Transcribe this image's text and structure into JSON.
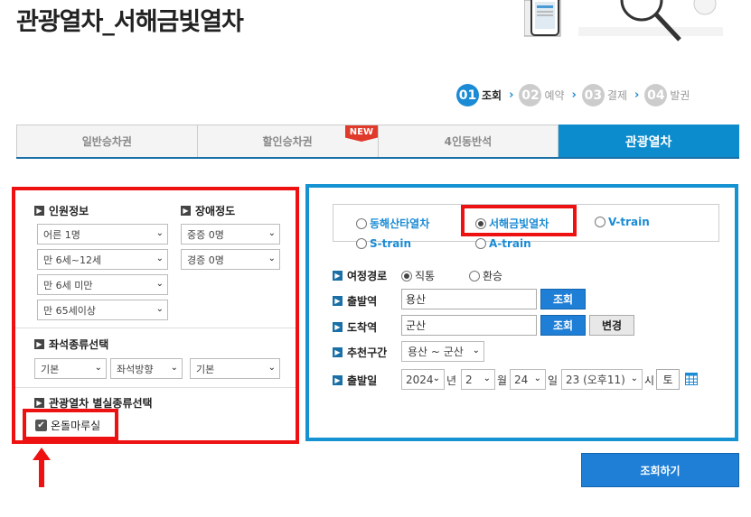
{
  "page_title": "관광열차_서해금빛열차",
  "steps": [
    {
      "num": "01",
      "label": "조회",
      "active": true
    },
    {
      "num": "02",
      "label": "예약",
      "active": false
    },
    {
      "num": "03",
      "label": "결제",
      "active": false
    },
    {
      "num": "04",
      "label": "발권",
      "active": false
    }
  ],
  "tabs": [
    {
      "label": "일반승차권"
    },
    {
      "label": "할인승차권",
      "badge": "NEW"
    },
    {
      "label": "4인동반석"
    },
    {
      "label": "관광열차",
      "active": true
    }
  ],
  "passenger": {
    "title": "인원정보",
    "selects": [
      "어른 1명",
      "만 6세~12세",
      "만 6세 미만",
      "만 65세이상"
    ]
  },
  "disability": {
    "title": "장애정도",
    "selects": [
      "중증 0명",
      "경증 0명"
    ]
  },
  "seat_type": {
    "title": "좌석종류선택",
    "selects": [
      "기본",
      "좌석방향",
      "기본"
    ]
  },
  "room_type": {
    "title": "관광열차 별실종류선택",
    "checkbox_label": "온돌마루실",
    "checked": true
  },
  "trains": [
    {
      "label": "동해산타열차",
      "selected": false
    },
    {
      "label": "서해금빛열차",
      "selected": true
    },
    {
      "label": "V-train",
      "selected": false
    },
    {
      "label": "S-train",
      "selected": false
    },
    {
      "label": "A-train",
      "selected": false
    }
  ],
  "route": {
    "label": "여정경로",
    "options": [
      {
        "label": "직통",
        "selected": true
      },
      {
        "label": "환승",
        "selected": false
      }
    ]
  },
  "departure": {
    "label": "출발역",
    "value": "용산",
    "button": "조회"
  },
  "arrival": {
    "label": "도착역",
    "value": "군산",
    "button": "조회",
    "change_button": "변경"
  },
  "recommend": {
    "label": "추천구간",
    "value": "용산 ~ 군산"
  },
  "date": {
    "label": "출발일",
    "year": "2024",
    "year_unit": "년",
    "month": "2",
    "month_unit": "월",
    "day": "24",
    "day_unit": "일",
    "hour": "23 (오후11)",
    "hour_unit": "시",
    "weekday": "토",
    "calendar_icon": "calendar-icon"
  },
  "search_button": "조회하기",
  "colors": {
    "accent": "#1a8bd4",
    "highlight_red": "#ee1111",
    "panel_blue": "#1592d1"
  }
}
